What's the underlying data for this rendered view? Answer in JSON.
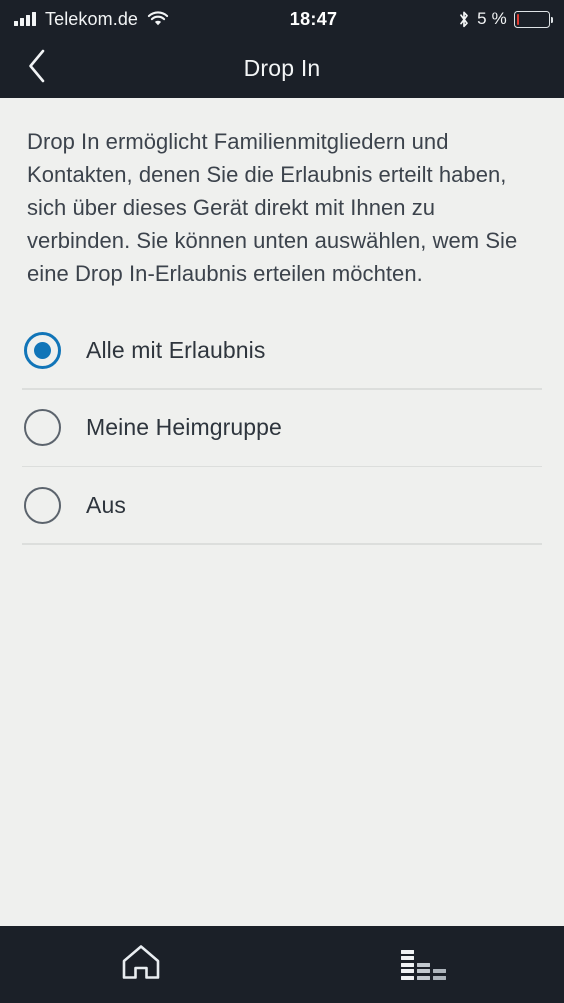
{
  "status_bar": {
    "carrier": "Telekom.de",
    "time": "18:47",
    "battery_percent": "5 %",
    "signal_icon": "signal-bars-icon",
    "wifi_icon": "wifi-icon",
    "bluetooth_icon": "bluetooth-icon",
    "battery_icon": "battery-icon",
    "battery_level_pct": 5,
    "battery_low_color": "#e03b32"
  },
  "navbar": {
    "title": "Drop In",
    "back_icon": "chevron-left-icon"
  },
  "main": {
    "description": "Drop In ermöglicht Familienmitgliedern und Kontakten, denen Sie die Erlaubnis erteilt haben, sich über dieses Gerät direkt mit Ihnen zu verbinden. Sie können unten auswählen, wem Sie eine Drop In-Erlaubnis erteilen möchten.",
    "options": [
      {
        "label": "Alle mit Erlaubnis",
        "selected": true
      },
      {
        "label": "Meine Heimgruppe",
        "selected": false
      },
      {
        "label": "Aus",
        "selected": false
      }
    ]
  },
  "tab_bar": {
    "home_icon": "home-icon",
    "activity_icon": "equalizer-bars-icon"
  },
  "colors": {
    "chrome_dark": "#1b2028",
    "page_background": "#eff0ee",
    "accent_blue": "#1175b8",
    "body_text": "#3c434c",
    "divider": "#dcdedc"
  }
}
